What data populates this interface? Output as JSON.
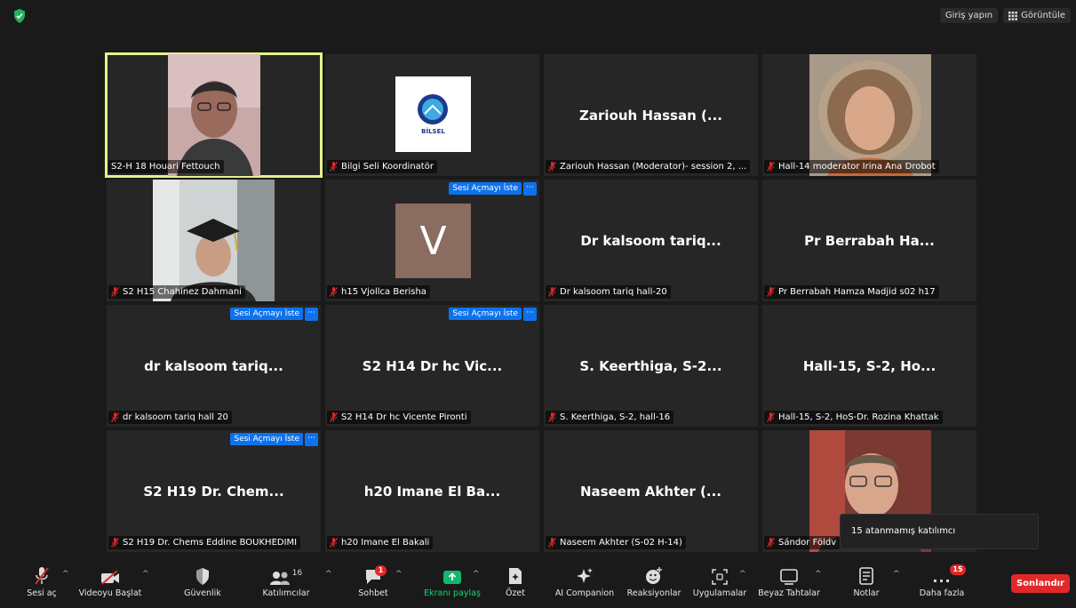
{
  "top": {
    "signin": "Giriş yapın",
    "view": "Görüntüle"
  },
  "tiles": [
    {
      "label": "S2-H 18  Houari Fettouch",
      "muted": false
    },
    {
      "label": "Bilgi Seli Koordinatör",
      "muted": true,
      "logo_text": "BİLSEL"
    },
    {
      "name": "Zariouh Hassan (...",
      "label": "Zariouh Hassan (Moderator)- session 2, ...",
      "muted": true
    },
    {
      "label": "Hall-14 moderator Irina Ana Drobot",
      "muted": true
    },
    {
      "label": "S2 H15 Chahinez Dahmani",
      "muted": true
    },
    {
      "initial": "V",
      "label": "h15 Vjollca Berisha",
      "muted": true
    },
    {
      "name": "Dr kalsoom tariq...",
      "label": "Dr kalsoom tariq hall-20",
      "muted": true
    },
    {
      "name": "Pr Berrabah Ha...",
      "label": "Pr Berrabah Hamza Madjid s02 h17",
      "muted": true
    },
    {
      "name": "dr kalsoom tariq...",
      "label": "dr kalsoom tariq hall  20",
      "muted": true
    },
    {
      "name": "S2 H14 Dr hc Vic...",
      "label": "S2 H14 Dr hc Vicente Pironti",
      "muted": true
    },
    {
      "name": "S. Keerthiga, S-2...",
      "label": "S. Keerthiga, S-2, hall-16",
      "muted": true
    },
    {
      "name": "Hall-15, S-2, Ho...",
      "label": "Hall-15, S-2, HoS-Dr. Rozina Khattak",
      "muted": true
    },
    {
      "name": "S2 H19 Dr. Chem...",
      "label": "S2 H19 Dr. Chems Eddine BOUKHEDIMI",
      "muted": true
    },
    {
      "name": "h20 Imane El Ba...",
      "label": "h20 Imane El Bakali",
      "muted": true
    },
    {
      "name": "Naseem Akhter (...",
      "label": "Naseem Akhter (S-02 H-14)",
      "muted": true
    },
    {
      "label": "Sándor Földv",
      "muted": true
    }
  ],
  "ask_label": "Sesi Açmayı İste",
  "more_label": "···",
  "tooltip": "15 atanmamış katılımcı",
  "toolbar": {
    "audio": "Sesi aç",
    "video": "Videoyu Başlat",
    "security": "Güvenlik",
    "participants": "Katılımcılar",
    "participants_count": "16",
    "chat": "Sohbet",
    "chat_badge": "1",
    "share": "Ekranı paylaş",
    "summary": "Özet",
    "ai": "AI Companion",
    "reactions": "Reaksiyonlar",
    "apps": "Uygulamalar",
    "whiteboard": "Beyaz Tahtalar",
    "notes": "Notlar",
    "more": "Daha fazla",
    "more_badge": "15",
    "more_dots": "...",
    "end": "Sonlandır"
  },
  "colors": {
    "accent_blue": "#0e72ed",
    "end_red": "#e02828",
    "share_green": "#12b76a",
    "active_border": "#e7f08a"
  }
}
